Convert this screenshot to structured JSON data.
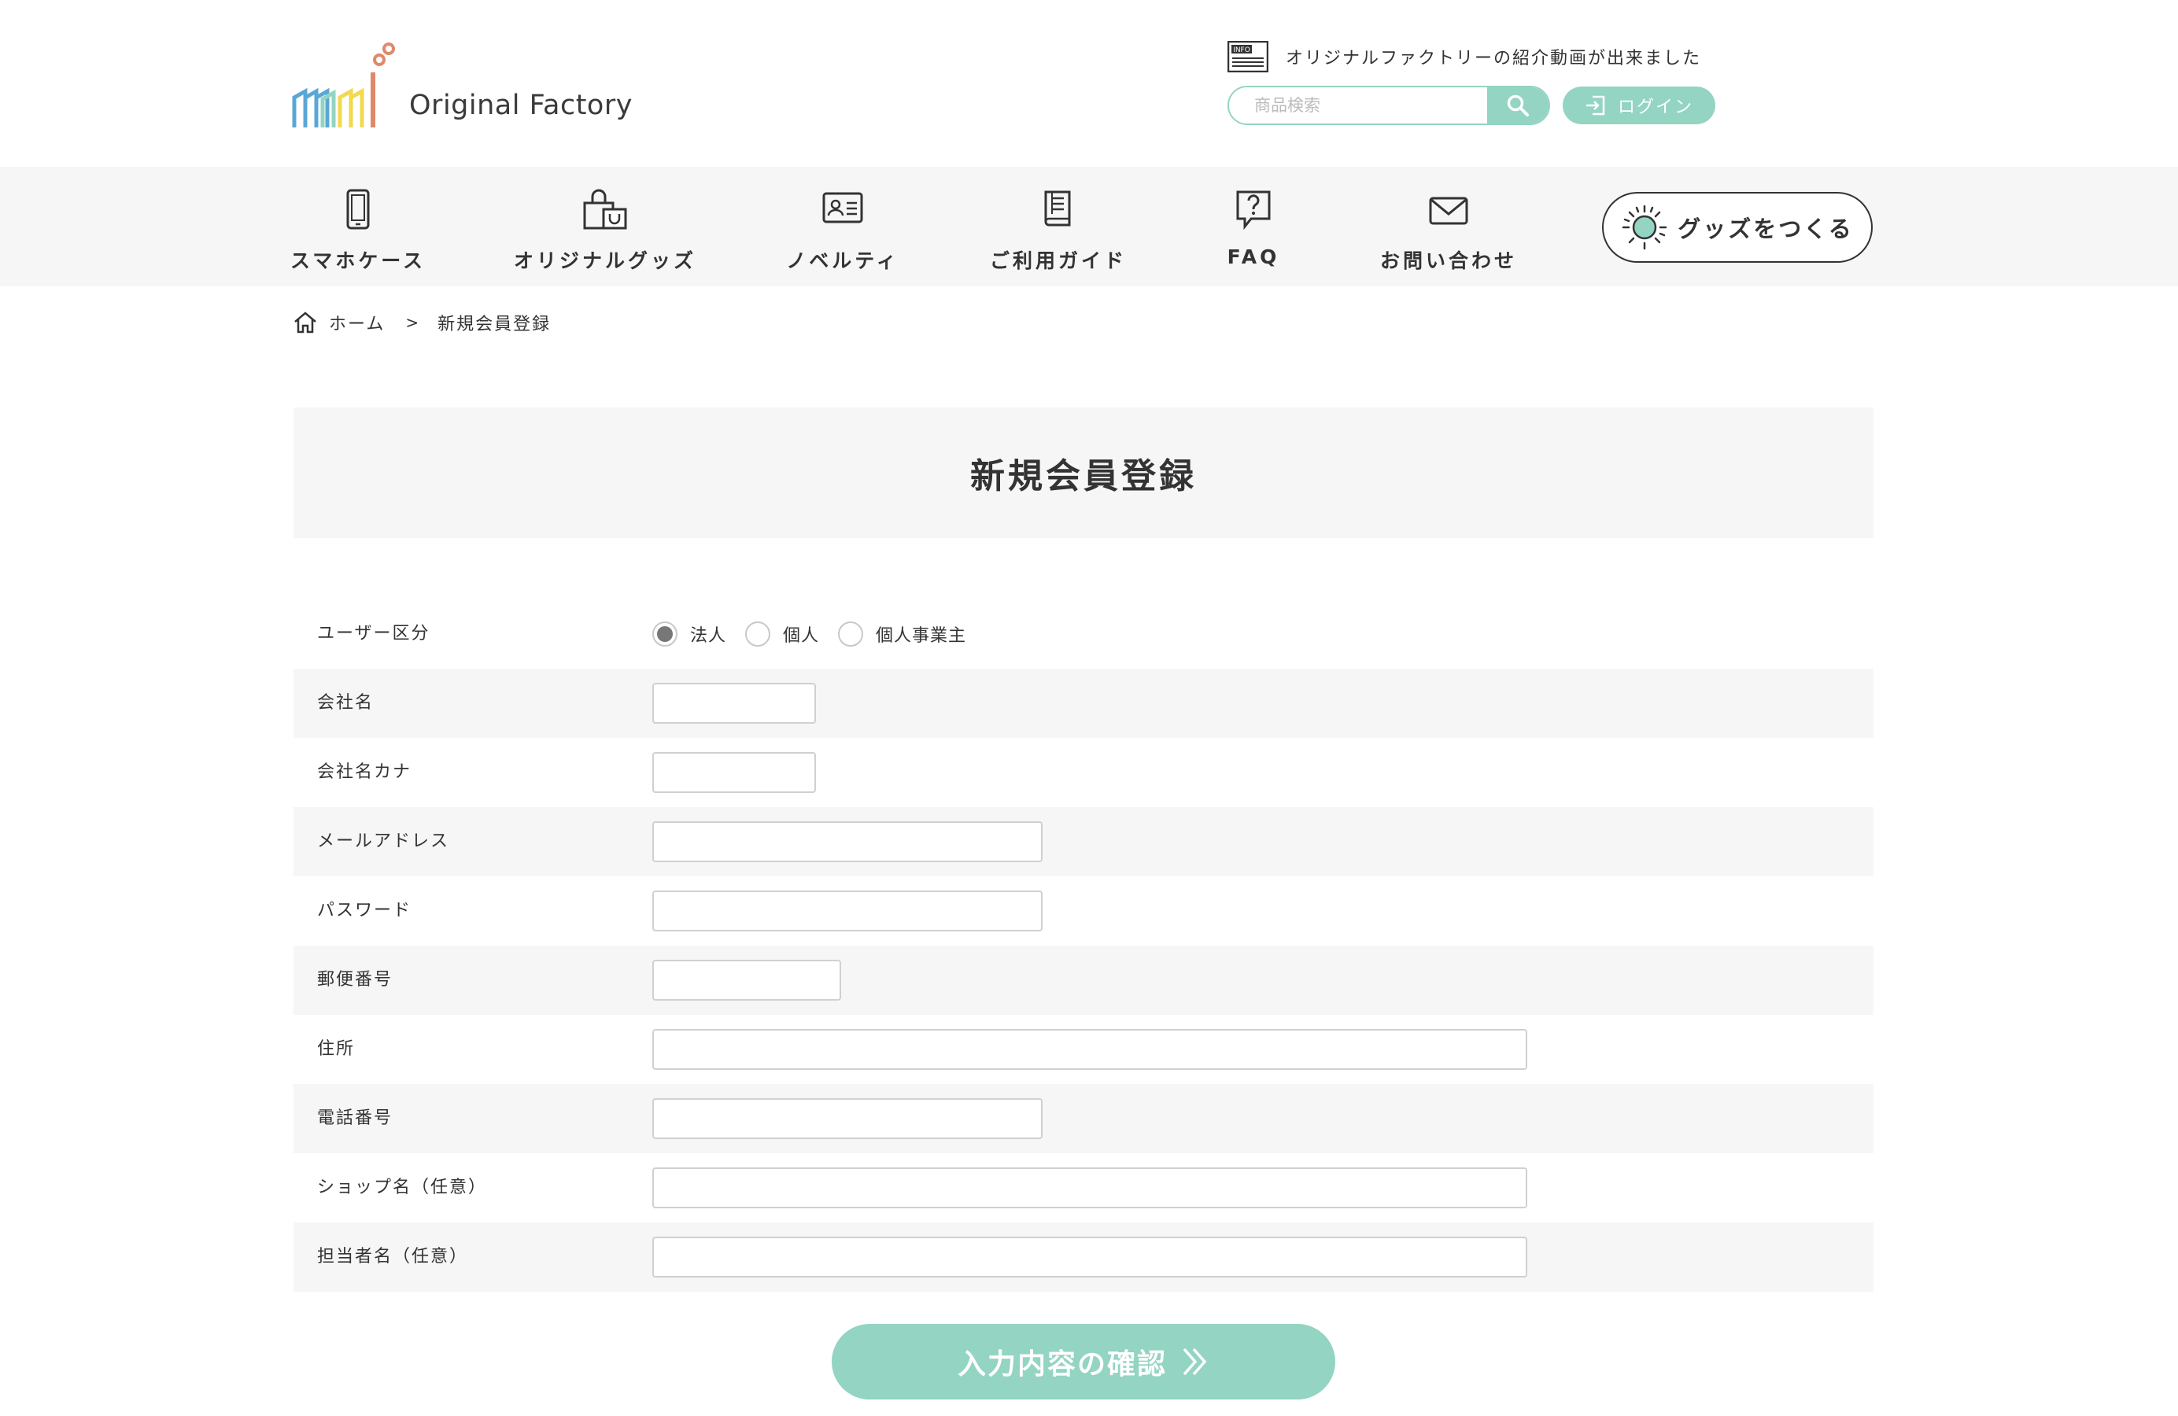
{
  "header": {
    "logo_text": "Original Factory",
    "info_badge": "INFO",
    "info_text": "オリジナルファクトリーの紹介動画が出来ました",
    "search_placeholder": "商品検索",
    "login_label": "ログイン"
  },
  "nav": {
    "items": [
      {
        "label": "スマホケース",
        "icon": "smartphone-icon"
      },
      {
        "label": "オリジナルグッズ",
        "icon": "shopping-bag-icon"
      },
      {
        "label": "ノベルティ",
        "icon": "id-card-icon"
      },
      {
        "label": "ご利用ガイド",
        "icon": "book-icon"
      },
      {
        "label": "FAQ",
        "icon": "question-icon"
      },
      {
        "label": "お問い合わせ",
        "icon": "mail-icon"
      }
    ],
    "make_button_label": "グッズをつくる"
  },
  "breadcrumb": {
    "home": "ホーム",
    "separator": ">",
    "current": "新規会員登録"
  },
  "page_title": "新規会員登録",
  "form": {
    "user_type": {
      "label": "ユーザー区分",
      "options": [
        "法人",
        "個人",
        "個人事業主"
      ],
      "selected": "法人"
    },
    "fields": [
      {
        "label": "会社名",
        "value": ""
      },
      {
        "label": "会社名カナ",
        "value": ""
      },
      {
        "label": "メールアドレス",
        "value": ""
      },
      {
        "label": "パスワード",
        "value": ""
      },
      {
        "label": "郵便番号",
        "value": ""
      },
      {
        "label": "住所",
        "value": ""
      },
      {
        "label": "電話番号",
        "value": ""
      },
      {
        "label": "ショップ名（任意）",
        "value": ""
      },
      {
        "label": "担当者名（任意）",
        "value": ""
      }
    ],
    "submit_label": "入力内容の確認"
  },
  "colors": {
    "accent": "#93d4c2",
    "panel_bg": "#f6f6f6",
    "text": "#333333"
  }
}
